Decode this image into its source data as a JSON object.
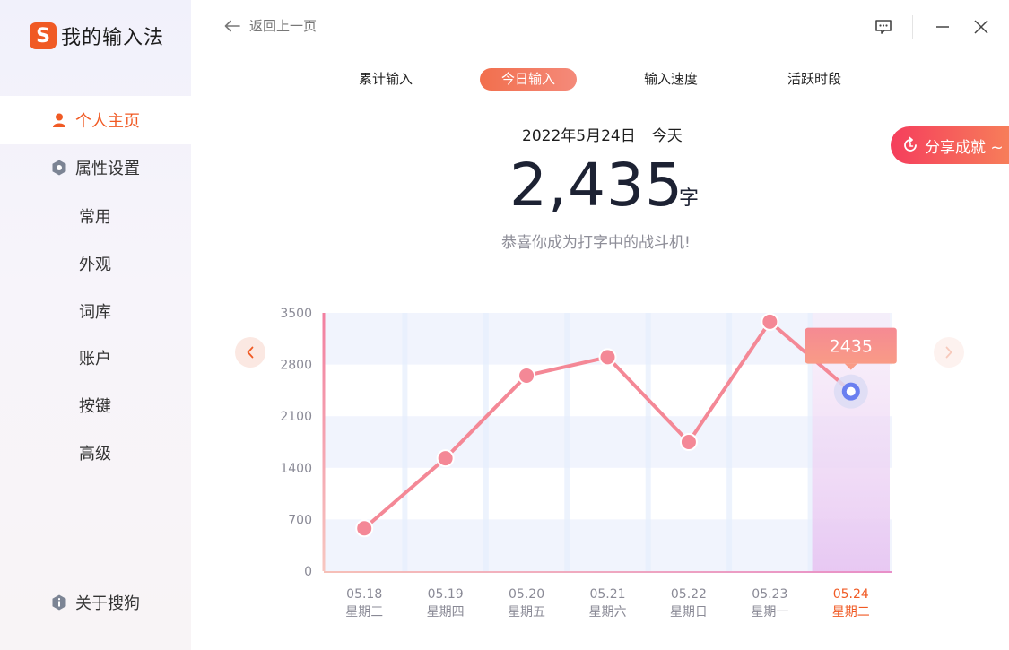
{
  "app": {
    "logo_letter": "S",
    "title": "我的输入法"
  },
  "sidebar": {
    "items": [
      {
        "label": "个人主页",
        "icon": "user-icon",
        "active": true
      },
      {
        "label": "属性设置",
        "icon": "hexagon-icon",
        "active": false
      },
      {
        "label": "常用"
      },
      {
        "label": "外观"
      },
      {
        "label": "词库"
      },
      {
        "label": "账户"
      },
      {
        "label": "按键"
      },
      {
        "label": "高级"
      }
    ],
    "about": {
      "label": "关于搜狗",
      "icon": "info-hexagon-icon"
    }
  },
  "topbar": {
    "back_label": "返回上一页",
    "icons": [
      "feedback-icon",
      "minimize-icon",
      "close-icon"
    ]
  },
  "tabs": [
    {
      "label": "累计输入",
      "active": false
    },
    {
      "label": "今日输入",
      "active": true
    },
    {
      "label": "输入速度",
      "active": false
    },
    {
      "label": "活跃时段",
      "active": false
    }
  ],
  "stats": {
    "date": "2022年5月24日",
    "today": "今天",
    "count": "2,435",
    "unit": "字",
    "message": "恭喜你成为打字中的战斗机!"
  },
  "share": {
    "label": "分享成就 ~",
    "icon": "share-refresh-icon"
  },
  "chart_data": {
    "type": "line",
    "ylim": [
      0,
      3500
    ],
    "yticks": [
      "3500",
      "2800",
      "2100",
      "1400",
      "700",
      "0"
    ],
    "categories": [
      "05.18",
      "05.19",
      "05.20",
      "05.21",
      "05.22",
      "05.23",
      "05.24"
    ],
    "weekdays": [
      "星期三",
      "星期四",
      "星期五",
      "星期六",
      "星期日",
      "星期一",
      "星期二"
    ],
    "values": [
      580,
      1530,
      2650,
      2900,
      1750,
      3380,
      2435
    ],
    "highlight_index": 6,
    "highlight_label": "2435",
    "line_color": "#f48896",
    "highlight_color": "#f05a24",
    "grid": true
  },
  "colors": {
    "accent": "#f05a24",
    "line": "#f48896",
    "text_muted": "#8e8e98"
  }
}
